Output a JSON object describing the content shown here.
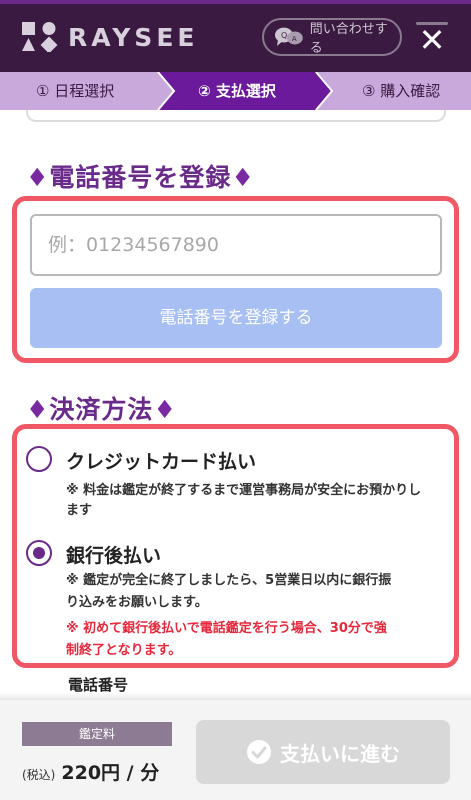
{
  "header": {
    "brand": "RAYSEE",
    "contact_label": "問い合わせする",
    "close_glyph": "✕"
  },
  "steps": [
    {
      "label": "① 日程選択",
      "state": "done"
    },
    {
      "label": "② 支払選択",
      "state": "active"
    },
    {
      "label": "③ 購入確認",
      "state": "todo"
    }
  ],
  "phone_section": {
    "heading_mark": "♦",
    "heading": "電話番号を登録",
    "placeholder": "例：01234567890",
    "value": "",
    "register_label": "電話番号を登録する"
  },
  "payment_section": {
    "heading_mark": "♦",
    "heading": "決済方法",
    "options": [
      {
        "title": "クレジットカード払い",
        "selected": false,
        "note_line1": "※ 料金は鑑定が終了するまで運営事務局が安全にお預かりし",
        "note_line2": "ます"
      },
      {
        "title": "銀行後払い",
        "selected": true,
        "note_line1": "※ 鑑定が完全に終了しましたら、5営業日以内に銀行振",
        "note_line2": "り込みをお願いします。",
        "warn_line1": "※ 初めて銀行後払いで電話鑑定を行う場合、30分で強",
        "warn_line2": "制終了となります。"
      }
    ]
  },
  "phone_label": "電話番号",
  "footer": {
    "fee_tag": "鑑定料",
    "tax_label": "(税込)",
    "price": "220円 / 分",
    "pay_label": "支払いに進む"
  },
  "colors": {
    "header_bg": "#3a1a40",
    "step_active": "#6a1a9a",
    "step_inactive": "#c9a8dc",
    "accent_purple": "#6a2a8a",
    "frame_red": "#f05866",
    "register_btn": "#a7bff2",
    "warning_red": "#e8283c",
    "pay_btn_disabled": "#d8d8d8"
  }
}
